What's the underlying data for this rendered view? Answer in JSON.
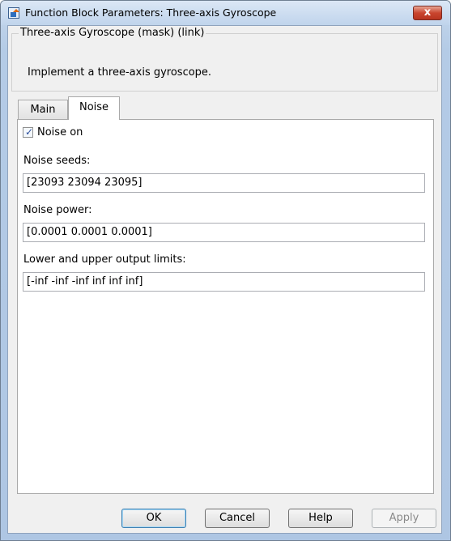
{
  "window": {
    "title": "Function Block Parameters: Three-axis Gyroscope",
    "close_label": "x"
  },
  "group": {
    "legend": "Three-axis Gyroscope (mask) (link)",
    "description": "Implement a three-axis gyroscope."
  },
  "tabs": [
    {
      "label": "Main",
      "active": false
    },
    {
      "label": "Noise",
      "active": true
    }
  ],
  "noise_tab": {
    "noise_on_label": "Noise on",
    "noise_on_checked": true,
    "noise_seeds_label": "Noise seeds:",
    "noise_seeds_value": "[23093 23094 23095]",
    "noise_power_label": "Noise power:",
    "noise_power_value": "[0.0001 0.0001 0.0001]",
    "limits_label": "Lower and upper output limits:",
    "limits_value": "[-inf  -inf  -inf  inf inf inf]"
  },
  "buttons": {
    "ok": "OK",
    "cancel": "Cancel",
    "help": "Help",
    "apply": "Apply"
  }
}
